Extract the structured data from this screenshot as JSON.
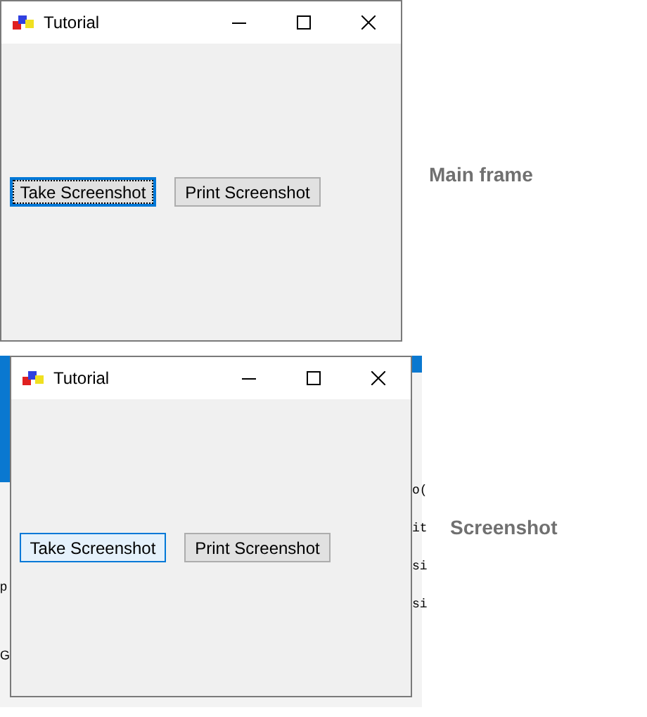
{
  "main_frame": {
    "window": {
      "title": "Tutorial",
      "buttons": [
        {
          "label": "Take Screenshot",
          "focused": true,
          "hovered": false
        },
        {
          "label": "Print Screenshot",
          "focused": false,
          "hovered": false
        }
      ]
    },
    "caption": "Main frame"
  },
  "screenshot": {
    "left_fragments": [
      "p",
      "G"
    ],
    "right_fragments": [
      "o(",
      "it",
      "si",
      "si"
    ],
    "window": {
      "title": "Tutorial",
      "buttons": [
        {
          "label": "Take Screenshot",
          "focused": false,
          "hovered": true
        },
        {
          "label": "Print Screenshot",
          "focused": false,
          "hovered": false
        }
      ]
    },
    "caption": "Screenshot"
  }
}
